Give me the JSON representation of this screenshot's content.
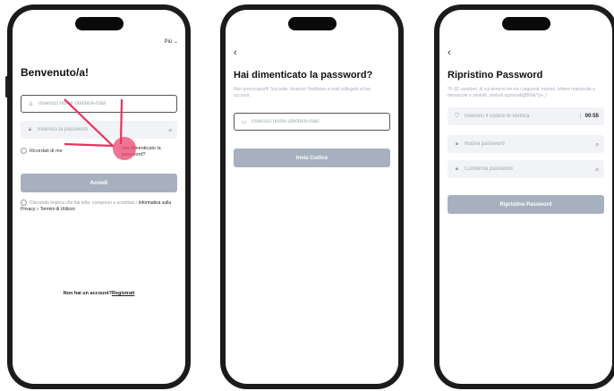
{
  "login": {
    "lang_label": "Più",
    "title": "Benvenuto/a!",
    "username_placeholder": "Inserisci nome utente/e-mail",
    "password_placeholder": "Inserisci la password",
    "remember_label": "Ricordati di me",
    "forgot_label": "Hai dimenticato la password?",
    "submit_label": "Accedi",
    "consent_text": "Cliccando implica che hai letto, compreso e accettato i",
    "privacy_link": "Informativa sulla Privacy",
    "and_text": "e",
    "terms_link": "Termini di Utilizzo",
    "no_account_text": "Non hai un account?",
    "register_link": "Registrati"
  },
  "forgot": {
    "back_icon": "chevron-left-icon",
    "title": "Hai dimenticato la password?",
    "subtitle": "Non preoccuparti! Succede. Inserisci l'indirizzo e-mail collegato al tuo account.",
    "username_placeholder": "Inserisci nome utente/e-mail",
    "submit_label": "Invia Codice"
  },
  "reset": {
    "back_icon": "chevron-left-icon",
    "title": "Ripristino Password",
    "subtitle": "*6~32 caratteri, di cui almeno tre tra i seguenti: numeri, lettere maiuscole o minuscole e simboli. simboli opzionali@$%&*()+_!",
    "code_placeholder": "Inserisci il codice di verifica",
    "timer": "00:55",
    "new_password_placeholder": "Nuova password",
    "confirm_password_placeholder": "Conferma password",
    "submit_label": "Ripristino Password"
  },
  "colors": {
    "primary_button": "#a7b0be",
    "field_bg": "#f2f3f6",
    "annotation": "#e8325f"
  }
}
